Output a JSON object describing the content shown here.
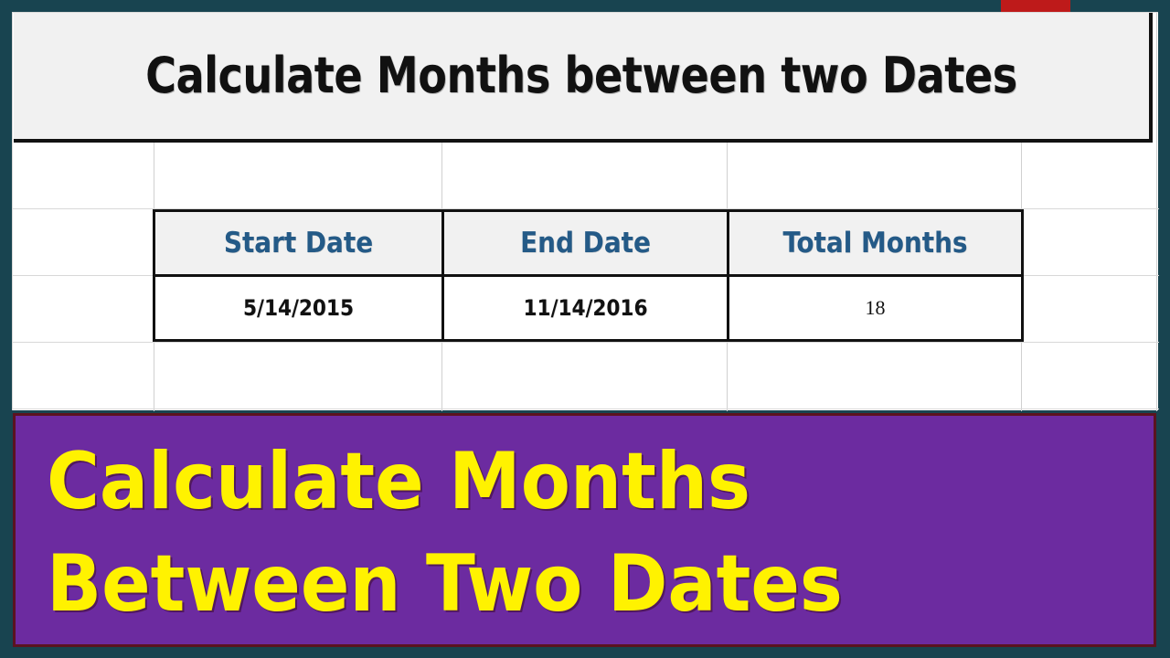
{
  "window": {
    "background_color": "#184450",
    "red_tab_color": "#BE1A1A"
  },
  "spreadsheet": {
    "title_cell": {
      "text": "Calculate Months between two Dates",
      "background_color": "#F1F1F1",
      "text_color": "#111111"
    },
    "table": {
      "headers": [
        "Start Date",
        "End Date",
        "Total Months"
      ],
      "header_text_color": "#245A87",
      "header_background": "#F1F1F1",
      "rows": [
        [
          "5/14/2015",
          "11/14/2016",
          "18"
        ]
      ]
    }
  },
  "banner": {
    "background_color": "#6C2BA0",
    "border_color": "#5B1320",
    "text_color": "#FFF200",
    "lines": [
      "Calculate Months",
      "Between Two Dates"
    ]
  }
}
